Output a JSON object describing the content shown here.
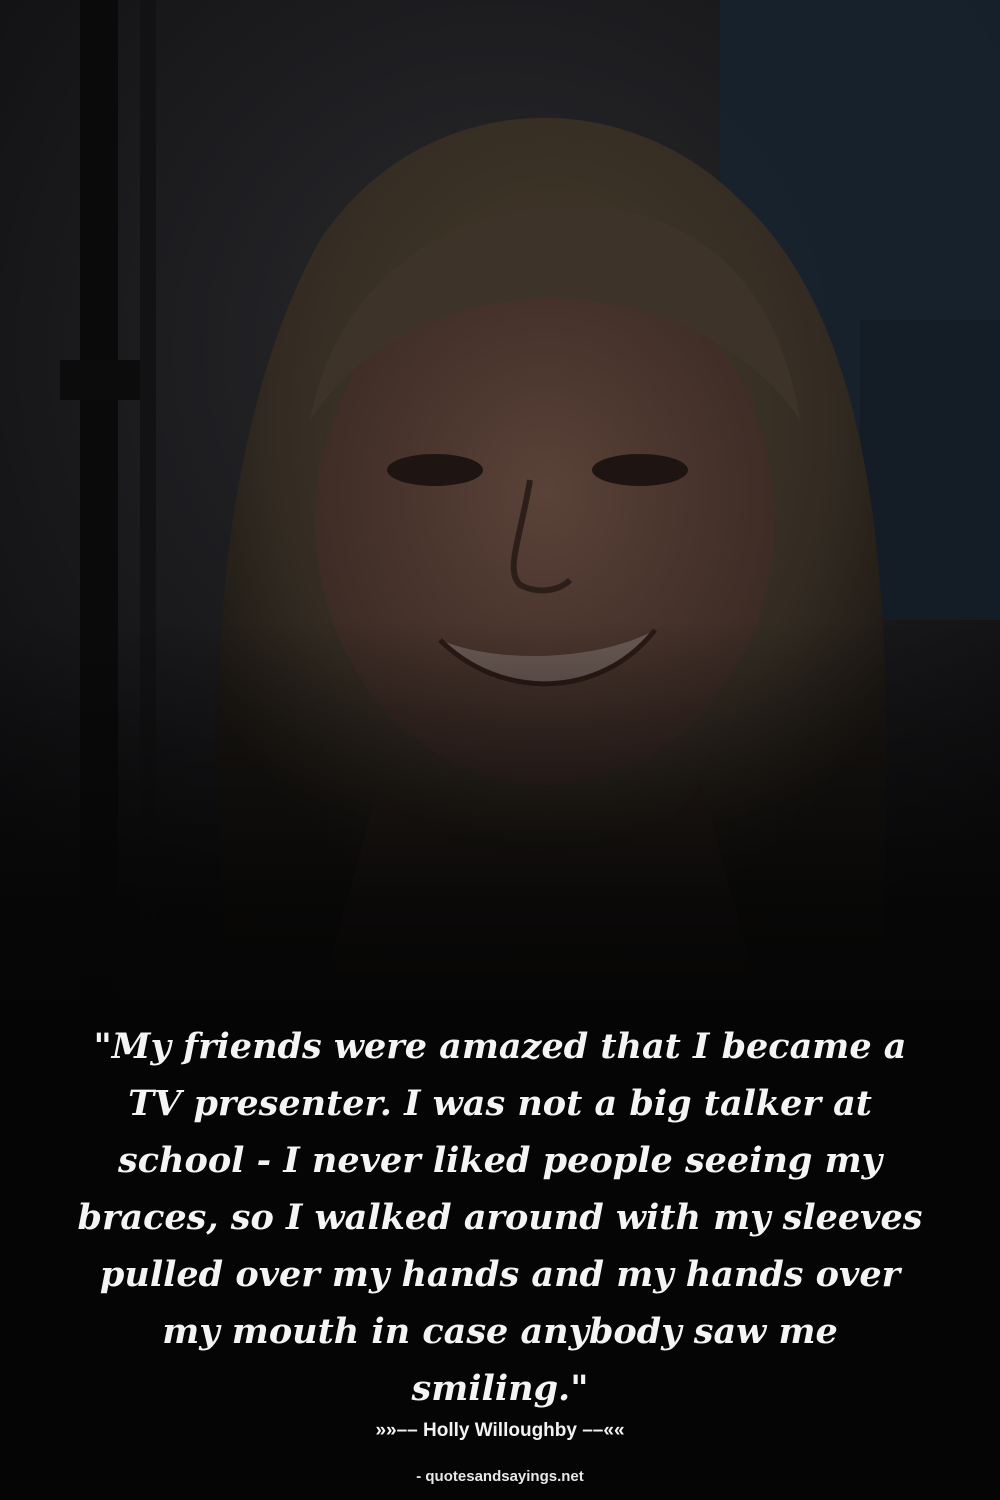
{
  "quote": {
    "text": "\"My friends were amazed that I became a TV presenter. I was not a big talker at school - I never liked people seeing my braces, so I walked around with my sleeves pulled over my hands and my hands over my mouth in case anybody saw me smiling.\""
  },
  "author": {
    "line": "»»–– Holly Willoughby ––««"
  },
  "source": {
    "line": "- quotesandsayings.net"
  },
  "colors": {
    "background": "#050505",
    "text": "#f4f4f4"
  }
}
